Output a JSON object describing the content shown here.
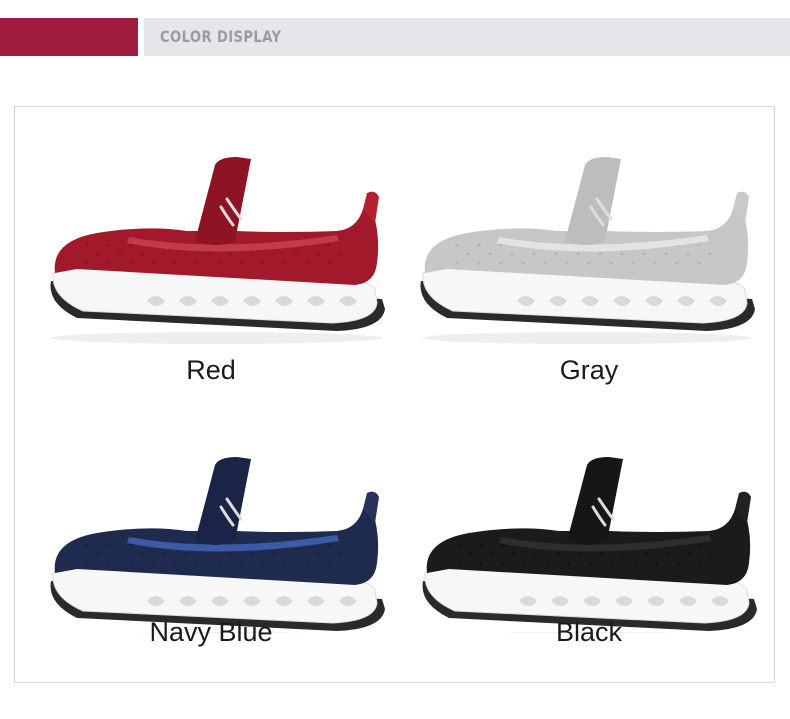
{
  "header": {
    "title": "COLOR DISPLAY",
    "accent_color": "#a11d3f",
    "band_color": "#e5e6ea"
  },
  "variants": [
    {
      "label": "Red",
      "upper": "#a3192c",
      "upper_dark": "#7d0f1f",
      "lining": "#c23a4c",
      "strap": "#8e1424",
      "heel": "#b3222f"
    },
    {
      "label": "Gray",
      "upper": "#c7c7c9",
      "upper_dark": "#a9a9ab",
      "lining": "#e3e3e5",
      "strap": "#bdbdbf",
      "heel": "#c9c9cb"
    },
    {
      "label": "Navy Blue",
      "upper": "#1f2a4f",
      "upper_dark": "#141c38",
      "lining": "#3d5aa8",
      "strap": "#1a2446",
      "heel": "#27335c"
    },
    {
      "label": "Black",
      "upper": "#1b1b1c",
      "upper_dark": "#0c0c0c",
      "lining": "#2e2e30",
      "strap": "#161617",
      "heel": "#222224"
    }
  ]
}
